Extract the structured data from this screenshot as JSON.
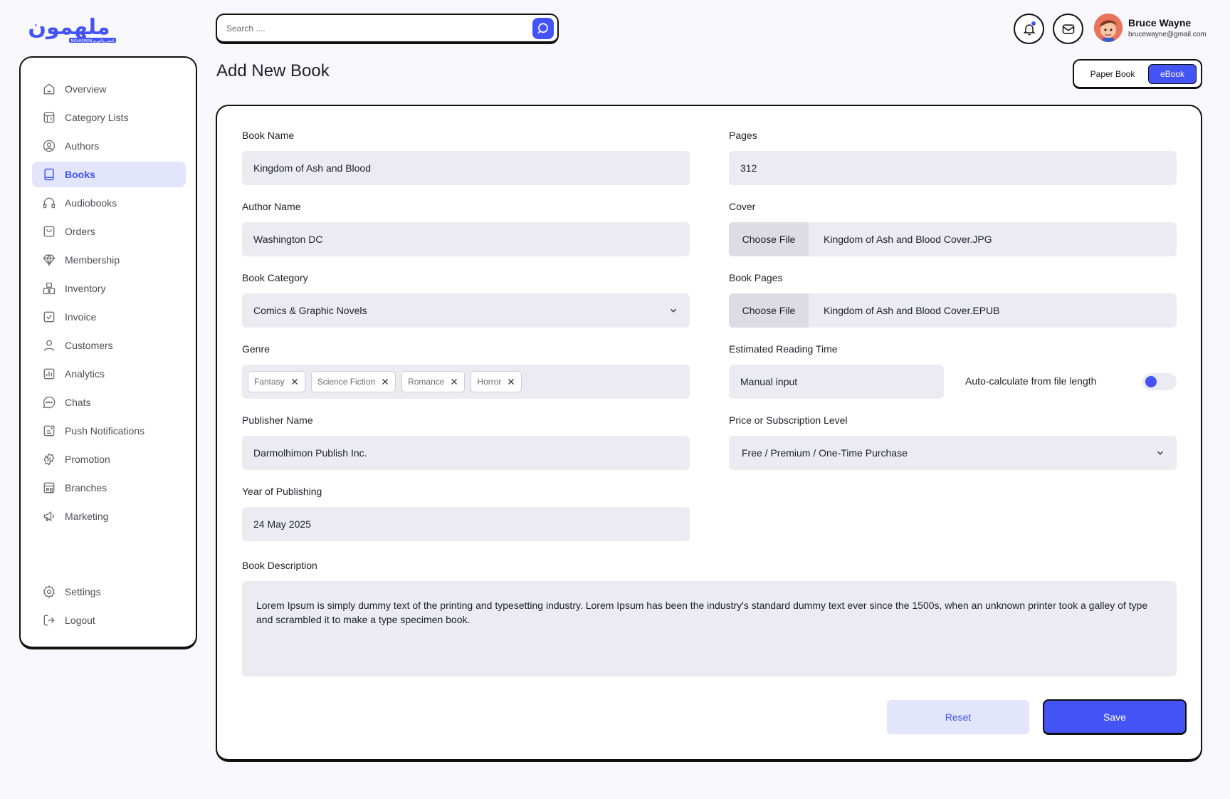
{
  "app": {
    "logo_text_main": "ملهمون",
    "logo_text_sub": "MOLHEMON للنشر والتوزيع"
  },
  "search": {
    "placeholder": "Search ...."
  },
  "user": {
    "name": "Bruce Wayne",
    "email": "brucewayne@gmail.com"
  },
  "sidebar": {
    "items": [
      {
        "label": "Overview",
        "icon": "home-icon"
      },
      {
        "label": "Category Lists",
        "icon": "category-icon"
      },
      {
        "label": "Authors",
        "icon": "user-circle-icon"
      },
      {
        "label": "Books",
        "icon": "book-icon"
      },
      {
        "label": "Audiobooks",
        "icon": "headphones-icon"
      },
      {
        "label": "Orders",
        "icon": "orders-icon"
      },
      {
        "label": "Membership",
        "icon": "diamond-icon"
      },
      {
        "label": "Inventory",
        "icon": "inventory-icon"
      },
      {
        "label": "Invoice",
        "icon": "invoice-icon"
      },
      {
        "label": "Customers",
        "icon": "customer-icon"
      },
      {
        "label": "Analytics",
        "icon": "analytics-icon"
      },
      {
        "label": "Chats",
        "icon": "chat-icon"
      },
      {
        "label": "Push Notifications",
        "icon": "push-notification-icon"
      },
      {
        "label": "Promotion",
        "icon": "promotion-icon"
      },
      {
        "label": "Branches",
        "icon": "branch-icon"
      },
      {
        "label": "Marketing",
        "icon": "megaphone-icon"
      }
    ],
    "bottom": [
      {
        "label": "Settings",
        "icon": "gear-icon"
      },
      {
        "label": "Logout",
        "icon": "logout-icon"
      }
    ],
    "active": "Books"
  },
  "page": {
    "title": "Add New Book"
  },
  "format_toggle": {
    "paper": "Paper Book",
    "ebook": "eBook",
    "selected": "eBook"
  },
  "form": {
    "book_name": {
      "label": "Book Name",
      "value": "Kingdom of Ash and Blood"
    },
    "author_name": {
      "label": "Author Name",
      "value": "Washington DC"
    },
    "book_category": {
      "label": "Book Category",
      "value": "Comics & Graphic Novels"
    },
    "genre": {
      "label": "Genre",
      "tags": [
        "Fantasy",
        "Science Fiction",
        "Romance",
        "Horror"
      ]
    },
    "publisher": {
      "label": "Publisher Name",
      "value": "Darmolhimon Publish Inc."
    },
    "year": {
      "label": "Year of Publishing",
      "value": "24 May 2025"
    },
    "pages": {
      "label": "Pages",
      "value": "312"
    },
    "cover": {
      "label": "Cover",
      "button": "Choose File",
      "file": "Kingdom of Ash and Blood Cover.JPG"
    },
    "book_pages": {
      "label": "Book Pages",
      "button": "Choose File",
      "file": "Kingdom of Ash and Blood Cover.EPUB"
    },
    "reading_time": {
      "label": "Estimated Reading Time",
      "value": "Manual input",
      "auto_label": "Auto-calculate from file length",
      "auto_enabled": false
    },
    "price": {
      "label": "Price or Subscription Level",
      "value": "Free / Premium / One-Time Purchase"
    },
    "description": {
      "label": "Book Description",
      "value": "Lorem Ipsum is simply dummy text of the printing and typesetting industry. Lorem Ipsum has been the industry's standard dummy text ever since the 1500s, when an unknown printer took a galley of type and scrambled it to make a type specimen book."
    },
    "reset_label": "Reset",
    "save_label": "Save"
  },
  "colors": {
    "accent": "#4353f6",
    "field_bg": "#ebebf1",
    "active_bg": "#e3e5fd"
  }
}
